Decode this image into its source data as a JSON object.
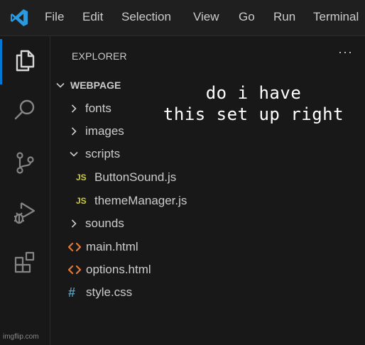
{
  "menubar": {
    "logo_icon": "vscode-logo-icon",
    "items": [
      "File",
      "Edit",
      "Selection",
      "View",
      "Go",
      "Run",
      "Terminal"
    ]
  },
  "activity_bar": {
    "icons": [
      "explorer-icon",
      "search-icon",
      "source-control-icon",
      "run-debug-icon",
      "extensions-icon"
    ],
    "active": "explorer-icon"
  },
  "sidebar": {
    "title": "EXPLORER",
    "more_actions": "···",
    "root": {
      "label": "WEBPAGE",
      "expanded": true
    },
    "tree": [
      {
        "type": "folder",
        "label": "fonts",
        "expanded": false
      },
      {
        "type": "folder",
        "label": "images",
        "expanded": false
      },
      {
        "type": "folder",
        "label": "scripts",
        "expanded": true
      },
      {
        "type": "js",
        "label": "ButtonSound.js",
        "icon_text": "JS"
      },
      {
        "type": "js",
        "label": "themeManager.js",
        "icon_text": "JS"
      },
      {
        "type": "folder",
        "label": "sounds",
        "expanded": false
      },
      {
        "type": "html",
        "label": "main.html"
      },
      {
        "type": "html",
        "label": "options.html"
      },
      {
        "type": "css",
        "label": "style.css",
        "icon_text": "#"
      }
    ]
  },
  "overlay_text": {
    "line1": "do i have",
    "line2": "this set up right"
  },
  "watermark": "imgflip.com",
  "colors": {
    "background": "#181818",
    "menubar_bg": "#1f1f1f",
    "text": "#cccccc",
    "accent": "#0078d4",
    "js": "#cbcb41",
    "html": "#e37933",
    "css": "#519aba"
  }
}
